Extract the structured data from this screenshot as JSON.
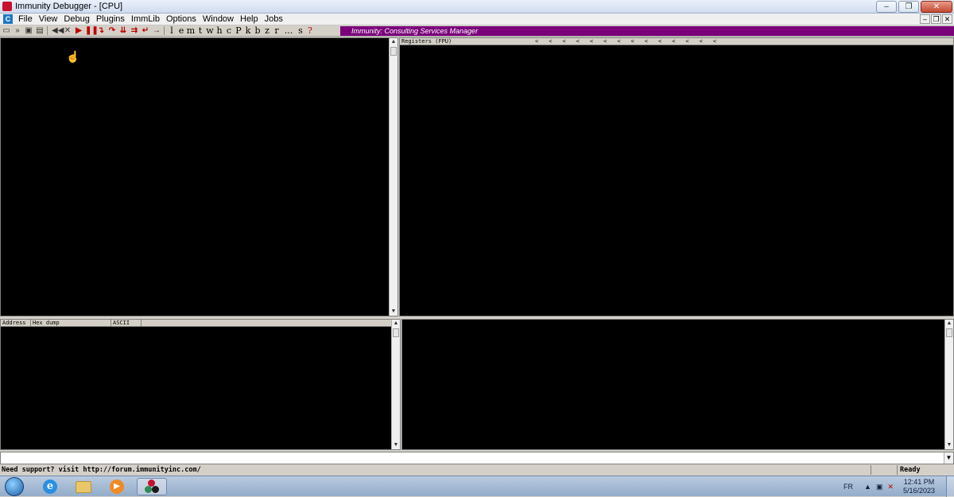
{
  "window": {
    "title": "Immunity Debugger - [CPU]",
    "min_glyph": "–",
    "restore_glyph": "❐",
    "close_glyph": "✕"
  },
  "menu": {
    "items": [
      "File",
      "View",
      "Debug",
      "Plugins",
      "ImmLib",
      "Options",
      "Window",
      "Help",
      "Jobs"
    ],
    "c_label": "C"
  },
  "toolbar": {
    "letters": [
      "l",
      "e",
      "m",
      "t",
      "w",
      "h",
      "c",
      "P",
      "k",
      "b",
      "z",
      "r",
      "...",
      "s",
      "?"
    ],
    "banner": "Immunity: Consulting Services Manager"
  },
  "panes": {
    "registers_header": "Registers (FPU)",
    "dump_headers": [
      "Address",
      "Hex dump",
      "ASCII"
    ]
  },
  "status": {
    "message": "Need support? visit http://forum.immunityinc.com/",
    "state": "Ready"
  },
  "taskbar": {
    "lang": "FR",
    "time": "12:41 PM",
    "date": "5/16/2023",
    "ie_letter": "e"
  }
}
